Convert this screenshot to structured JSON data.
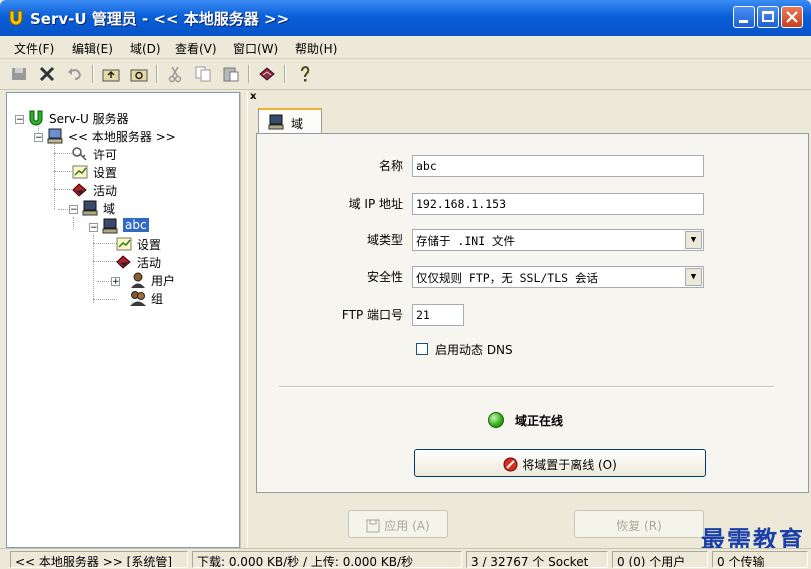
{
  "window": {
    "title": "Serv-U 管理员 - << 本地服务器 >>"
  },
  "menu": [
    "文件(F)",
    "编辑(E)",
    "域(D)",
    "查看(V)",
    "窗口(W)",
    "帮助(H)"
  ],
  "toolbar": {
    "icons": [
      "save-icon",
      "delete-icon",
      "undo-icon",
      "folder-up-icon",
      "folder-refresh-icon",
      "cut-icon",
      "copy-icon",
      "paste-icon",
      "book-icon",
      "help-icon"
    ]
  },
  "left_pane": {
    "close": "x",
    "tree": {
      "root": "Serv-U 服务器",
      "server": "<< 本地服务器 >>",
      "license": "许可",
      "settings": "设置",
      "activity": "活动",
      "domains": "域",
      "domain_abc": "abc",
      "domain_settings": "设置",
      "domain_activity": "活动",
      "users": "用户",
      "groups": "组"
    }
  },
  "right_pane": {
    "close": "x",
    "tab": "域",
    "form": {
      "name_label": "名称",
      "name_value": "abc",
      "ip_label": "域 IP 地址",
      "ip_value": "192.168.1.153",
      "type_label": "域类型",
      "type_value": "存储于 .INI 文件",
      "security_label": "安全性",
      "security_value": "仅仅规则 FTP，无 SSL/TLS 会话",
      "port_label": "FTP 端口号",
      "port_value": "21",
      "dyndns_label": "启用动态 DNS",
      "dyndns_checked": false
    },
    "status_text": "域正在线",
    "offline_button": "将域置于离线 (O)",
    "apply_button": "应用 (A)",
    "restore_button": "恢复 (R)"
  },
  "statusbar": {
    "server": "<< 本地服务器 >> [系统管]",
    "transfer": "下载: 0.000 KB/秒 / 上传: 0.000 KB/秒",
    "sockets": "3 / 32767 个 Socket",
    "users": "0 (0) 个用户",
    "transfers": "0 个传输"
  },
  "watermark": "最需教育",
  "colors": {
    "titlebar": "#0a5fd8",
    "selection": "#316ac5",
    "online_led": "#2ea814"
  }
}
